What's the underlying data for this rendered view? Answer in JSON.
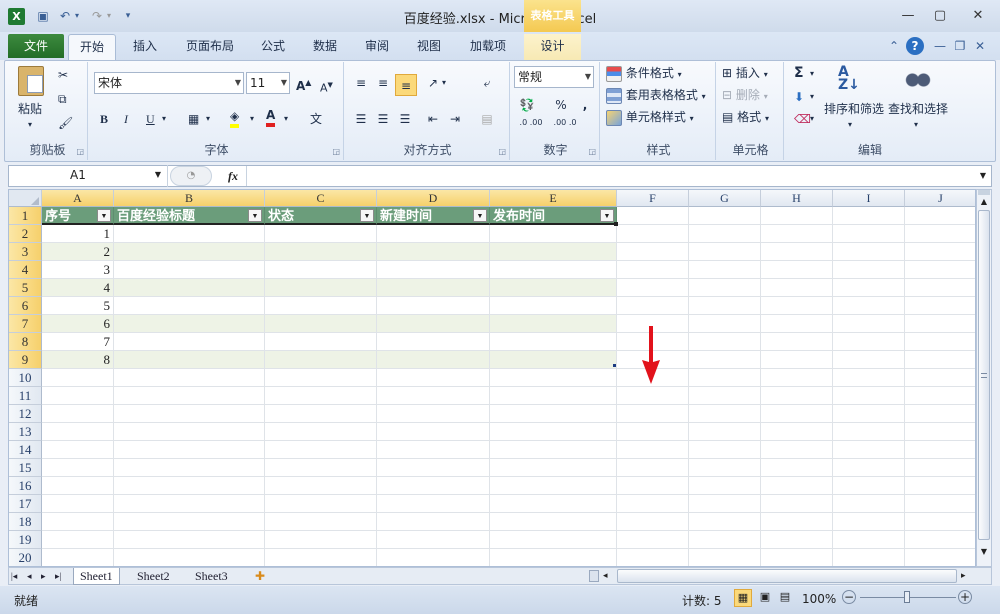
{
  "window": {
    "title": "百度经验.xlsx  -  Microsoft Excel",
    "context_tab_header": "表格工具",
    "min": "—",
    "max": "▢",
    "close": "✕"
  },
  "tabs": {
    "file": "文件",
    "home": "开始",
    "insert": "插入",
    "page_layout": "页面布局",
    "formulas": "公式",
    "data": "数据",
    "review": "审阅",
    "view": "视图",
    "addins": "加载项",
    "design": "设计"
  },
  "ribbon": {
    "clipboard": {
      "label": "剪贴板",
      "paste": "粘贴"
    },
    "font": {
      "label": "字体",
      "name": "宋体",
      "size": "11",
      "bold": "B",
      "italic": "I",
      "underline": "U",
      "grow": "A",
      "shrink": "A",
      "font_color_letter": "A",
      "phonetic": "文"
    },
    "alignment": {
      "label": "对齐方式"
    },
    "number": {
      "label": "数字",
      "format": "常规",
      "percent": "%",
      "comma": ",",
      "inc_decimal": ".0 .00",
      "dec_decimal": ".00 .0"
    },
    "styles": {
      "label": "样式",
      "conditional": "条件格式",
      "table_style": "套用表格格式",
      "cell_style": "单元格样式"
    },
    "cells": {
      "label": "单元格",
      "insert": "插入",
      "delete": "删除",
      "format": "格式"
    },
    "editing": {
      "label": "编辑",
      "sum": "Σ",
      "sort_filter": "排序和筛选",
      "find_select": "查找和选择"
    }
  },
  "formula_bar": {
    "name_box": "A1",
    "fx": "fx",
    "value": ""
  },
  "grid": {
    "columns": [
      "A",
      "B",
      "C",
      "D",
      "E",
      "F",
      "G",
      "H",
      "I",
      "J"
    ],
    "rows": [
      "1",
      "2",
      "3",
      "4",
      "5",
      "6",
      "7",
      "8",
      "9",
      "10",
      "11",
      "12",
      "13",
      "14",
      "15",
      "16",
      "17",
      "18",
      "19",
      "20"
    ],
    "table_headers": [
      "序号",
      "百度经验标题",
      "状态",
      "新建时间",
      "发布时间"
    ],
    "serials": [
      "1",
      "2",
      "3",
      "4",
      "5",
      "6",
      "7",
      "8"
    ]
  },
  "sheets": [
    "Sheet1",
    "Sheet2",
    "Sheet3"
  ],
  "status": {
    "ready": "就绪",
    "count": "计数: 5",
    "zoom": "100%"
  },
  "colors": {
    "table_header": "#6b9d7b",
    "band": "#eef3e6",
    "file_tab": "#2f7d32",
    "arrow": "#e2121b"
  }
}
